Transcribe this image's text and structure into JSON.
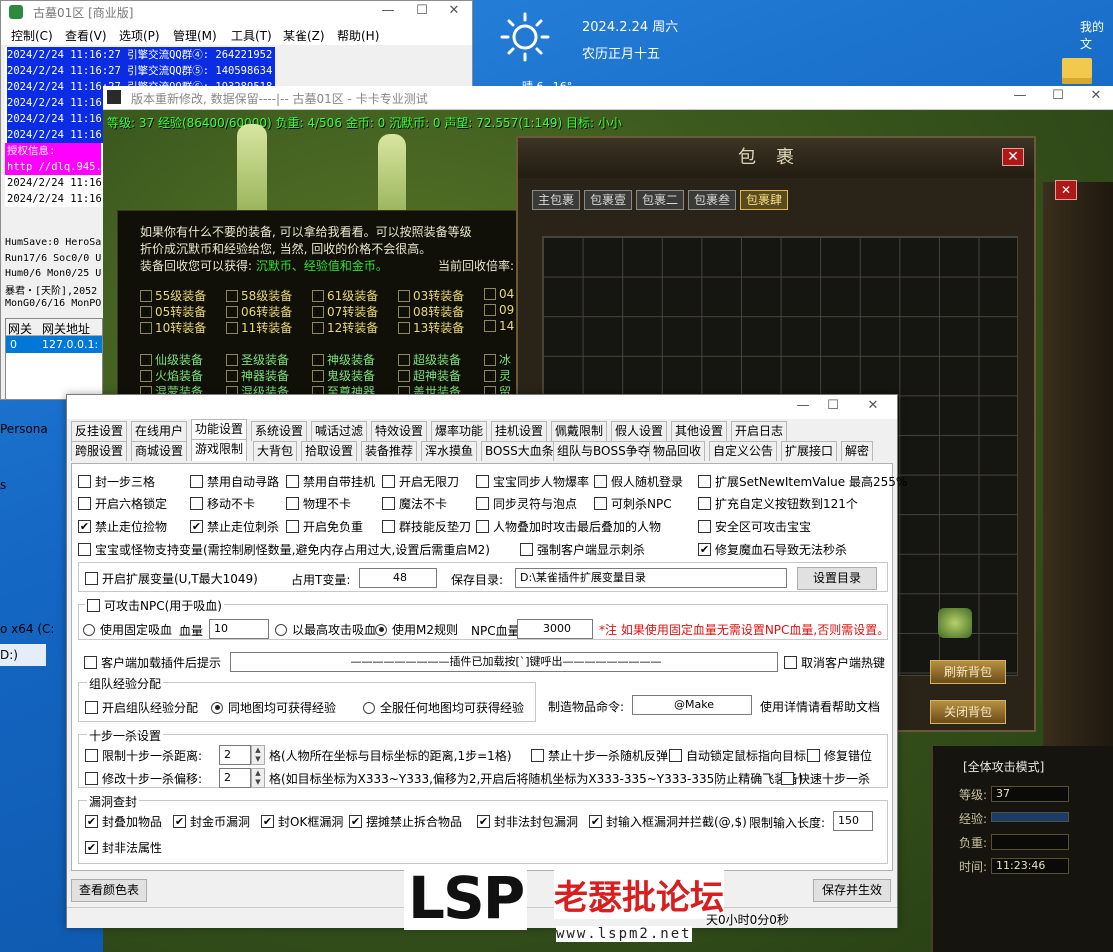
{
  "desktop": {
    "date": "2024.2.24  周六",
    "lunar": "农历正月十五",
    "weather": "晴  6~16°",
    "my_pc": "我的文",
    "left_fragments": [
      "Persona",
      "s",
      "o x64 (C:",
      "D:)"
    ]
  },
  "server": {
    "title": "古墓01区 [商业版]",
    "menu": [
      "控制(C)",
      "查看(V)",
      "选项(P)",
      "管理(M)",
      "工具(T)",
      "某雀(Z)",
      "帮助(H)"
    ],
    "logs": [
      "2024/2/24 11:16:27 引擎交流QQ群④: 264221952",
      "2024/2/24 11:16:27 引擎交流QQ群⑤: 140598634",
      "2024/2/24 11:16:27 引擎交流QQ群⑥: 193289518",
      "2024/2/24 11:16:27 引擎交流QQ群⑦",
      "2024/2/24 11:16:27 引擎交流QQ群⑧",
      "2024/2/24 11:16:27 引擎交流QQ群⑨"
    ],
    "auth_label": "授权信息:",
    "auth_url": "http //dlq.945.",
    "logs2": [
      "2024/2/24 11:16:",
      "2024/2/24 11:16:"
    ],
    "stats": [
      "HumSave:0 HeroSa",
      "Run17/6 Soc0/0 U",
      "Hum0/6 Mon0/25 U",
      "暴君・[天阶],2052",
      "MonG0/6/16 MonPO"
    ],
    "gw_headers": [
      "网关",
      "网关地址"
    ],
    "gw_row": [
      "0",
      "127.0.0.1:"
    ]
  },
  "game": {
    "title": "版本重新修改, 数据保留----|-- 古墓01区 - 卡卡专业测试",
    "status": "等级: 37 经验(86400/60000) 负重: 4/506 金币: 0 沉默币: 0 声望: 72.557(1:149) 目标: 小小",
    "recycle": {
      "line1": "如果你有什么不要的装备, 可以拿给我看看。可以按照装备等级",
      "line2": "折价成沉默币和经验给您, 当然, 回收的价格不会很高。",
      "line3_prefix": "装备回收您可以获得: ",
      "line3_green": "沉默币、经验值和金币。",
      "rate": "当前回收倍率:",
      "items_gold": [
        "55级装备",
        "58级装备",
        "61级装备",
        "03转装备",
        "04",
        "05转装备",
        "06转装备",
        "07转装备",
        "08转装备",
        "09",
        "10转装备",
        "11转装备",
        "12转装备",
        "13转装备",
        "14"
      ],
      "items_green": [
        "仙级装备",
        "圣级装备",
        "神级装备",
        "超级装备",
        "冰",
        "火焰装备",
        "神器装备",
        "鬼级装备",
        "超神装备",
        "灵",
        "混蒙装备",
        "混级装备",
        "至尊神器",
        "盖世装备",
        "留"
      ]
    },
    "bag": {
      "title": "包裹",
      "close": "✕",
      "tabs": [
        "主包裹",
        "包裹壹",
        "包裹二",
        "包裹叁",
        "包裹肆"
      ],
      "active_tab": 4,
      "btn_refresh": "刷新背包",
      "btn_close": "关闭背包"
    },
    "hud": {
      "mode": "[全体攻击模式]",
      "level_label": "等级:",
      "level_value": "37",
      "exp_label": "经验:",
      "weight_label": "负重:",
      "time_label": "时间:",
      "time_value": "11:23:46"
    }
  },
  "dialog": {
    "tabs_row1": [
      "反挂设置",
      "在线用户",
      "功能设置",
      "系统设置",
      "喊话过滤",
      "特效设置",
      "爆率功能",
      "挂机设置",
      "佩戴限制",
      "假人设置",
      "其他设置",
      "开启日志"
    ],
    "tabs_row2": [
      "跨服设置",
      "商城设置",
      "游戏限制",
      "大背包",
      "拾取设置",
      "装备推荐",
      "浑水摸鱼",
      "BOSS大血条",
      "组队与BOSS争夺",
      "物品回收",
      "自定义公告",
      "扩展接口",
      "解密"
    ],
    "active_tab1": 2,
    "active_tab2": 2,
    "checks": {
      "c1": "封一步三格",
      "c2": "禁用自动寻路",
      "c3": "禁用自带挂机",
      "c4": "开启无限刀",
      "c5": "宝宝同步人物爆率",
      "c6": "假人随机登录",
      "c7": "扩展SetNewItemValue 最高255%",
      "c8": "开启六格锁定",
      "c9": "移动不卡",
      "c10": "物理不卡",
      "c11": "魔法不卡",
      "c12": "同步灵符与泡点",
      "c13": "可刺杀NPC",
      "c14": "扩充自定义按钮数到121个",
      "c15": "禁止走位捡物",
      "c16": "禁止走位刺杀",
      "c17": "开启免负重",
      "c18": "群技能反垫刀",
      "c19": "人物叠加时攻击最后叠加的人物",
      "c20": "安全区可攻击宝宝",
      "c21": "宝宝或怪物支持变量(需控制刷怪数量,避免内存占用过大,设置后需重启M2)",
      "c22": "强制客户端显示刺杀",
      "c23": "修复魔血石导致无法秒杀"
    },
    "ext": {
      "check": "开启扩展变量(U,T最大1049)",
      "occupy_label": "占用T变量:",
      "occupy_value": "48",
      "dir_label": "保存目录:",
      "dir_value": "D:\\某雀插件扩展变量目录",
      "dir_btn": "设置目录"
    },
    "npc": {
      "check": "可攻击NPC(用于吸血)",
      "r1": "使用固定吸血",
      "hp_label": "血量",
      "hp_value": "10",
      "r2": "以最高攻击吸血",
      "r3": "使用M2规则",
      "npc_hp_label": "NPC血量",
      "npc_hp_value": "3000",
      "note": "*注 如果使用固定血量无需设置NPC血量,否则需设置。"
    },
    "client": {
      "check": "客户端加载插件后提示",
      "text": "—————————插件已加载按[`]键呼出—————————",
      "cancel": "取消客户端热键"
    },
    "team": {
      "title": "组队经验分配",
      "check": "开启组队经验分配",
      "r1": "同地图均可获得经验",
      "r2": "全服任何地图均可获得经验",
      "make_label": "制造物品命令:",
      "make_value": "@Make",
      "help": "使用详情请看帮助文档"
    },
    "ten": {
      "title": "十步一杀设置",
      "c1": "限制十步一杀距离:",
      "v1": "2",
      "t1": "格(人物所在坐标与目标坐标的距离,1步=1格)",
      "c2": "禁止十步一杀随机反弹",
      "c3": "自动锁定鼠标指向目标",
      "c4": "修复错位",
      "c5": "修改十步一杀偏移:",
      "v2": "2",
      "t2": "格(如目标坐标为X333~Y333,偏移为2,开启后将随机坐标为X333-335~Y333-335防止精确飞装备)",
      "c6": "快速十步一杀"
    },
    "leak": {
      "title": "漏洞查封",
      "c1": "封叠加物品",
      "c2": "封金币漏洞",
      "c3": "封OK框漏洞",
      "c4": "摆摊禁止拆合物品",
      "c5": "封非法封包漏洞",
      "c6": "封输入框漏洞并拦截(@,$)",
      "limit_label": "限制输入长度:",
      "limit_value": "150",
      "c7": "封非法属性"
    },
    "btn_colors": "查看颜色表",
    "btn_save": "保存并生效"
  },
  "watermark": {
    "lsp": "LSP",
    "cn": "老瑟批论坛",
    "url": "www.lspm2.net"
  },
  "clock": "天0小时0分0秒"
}
